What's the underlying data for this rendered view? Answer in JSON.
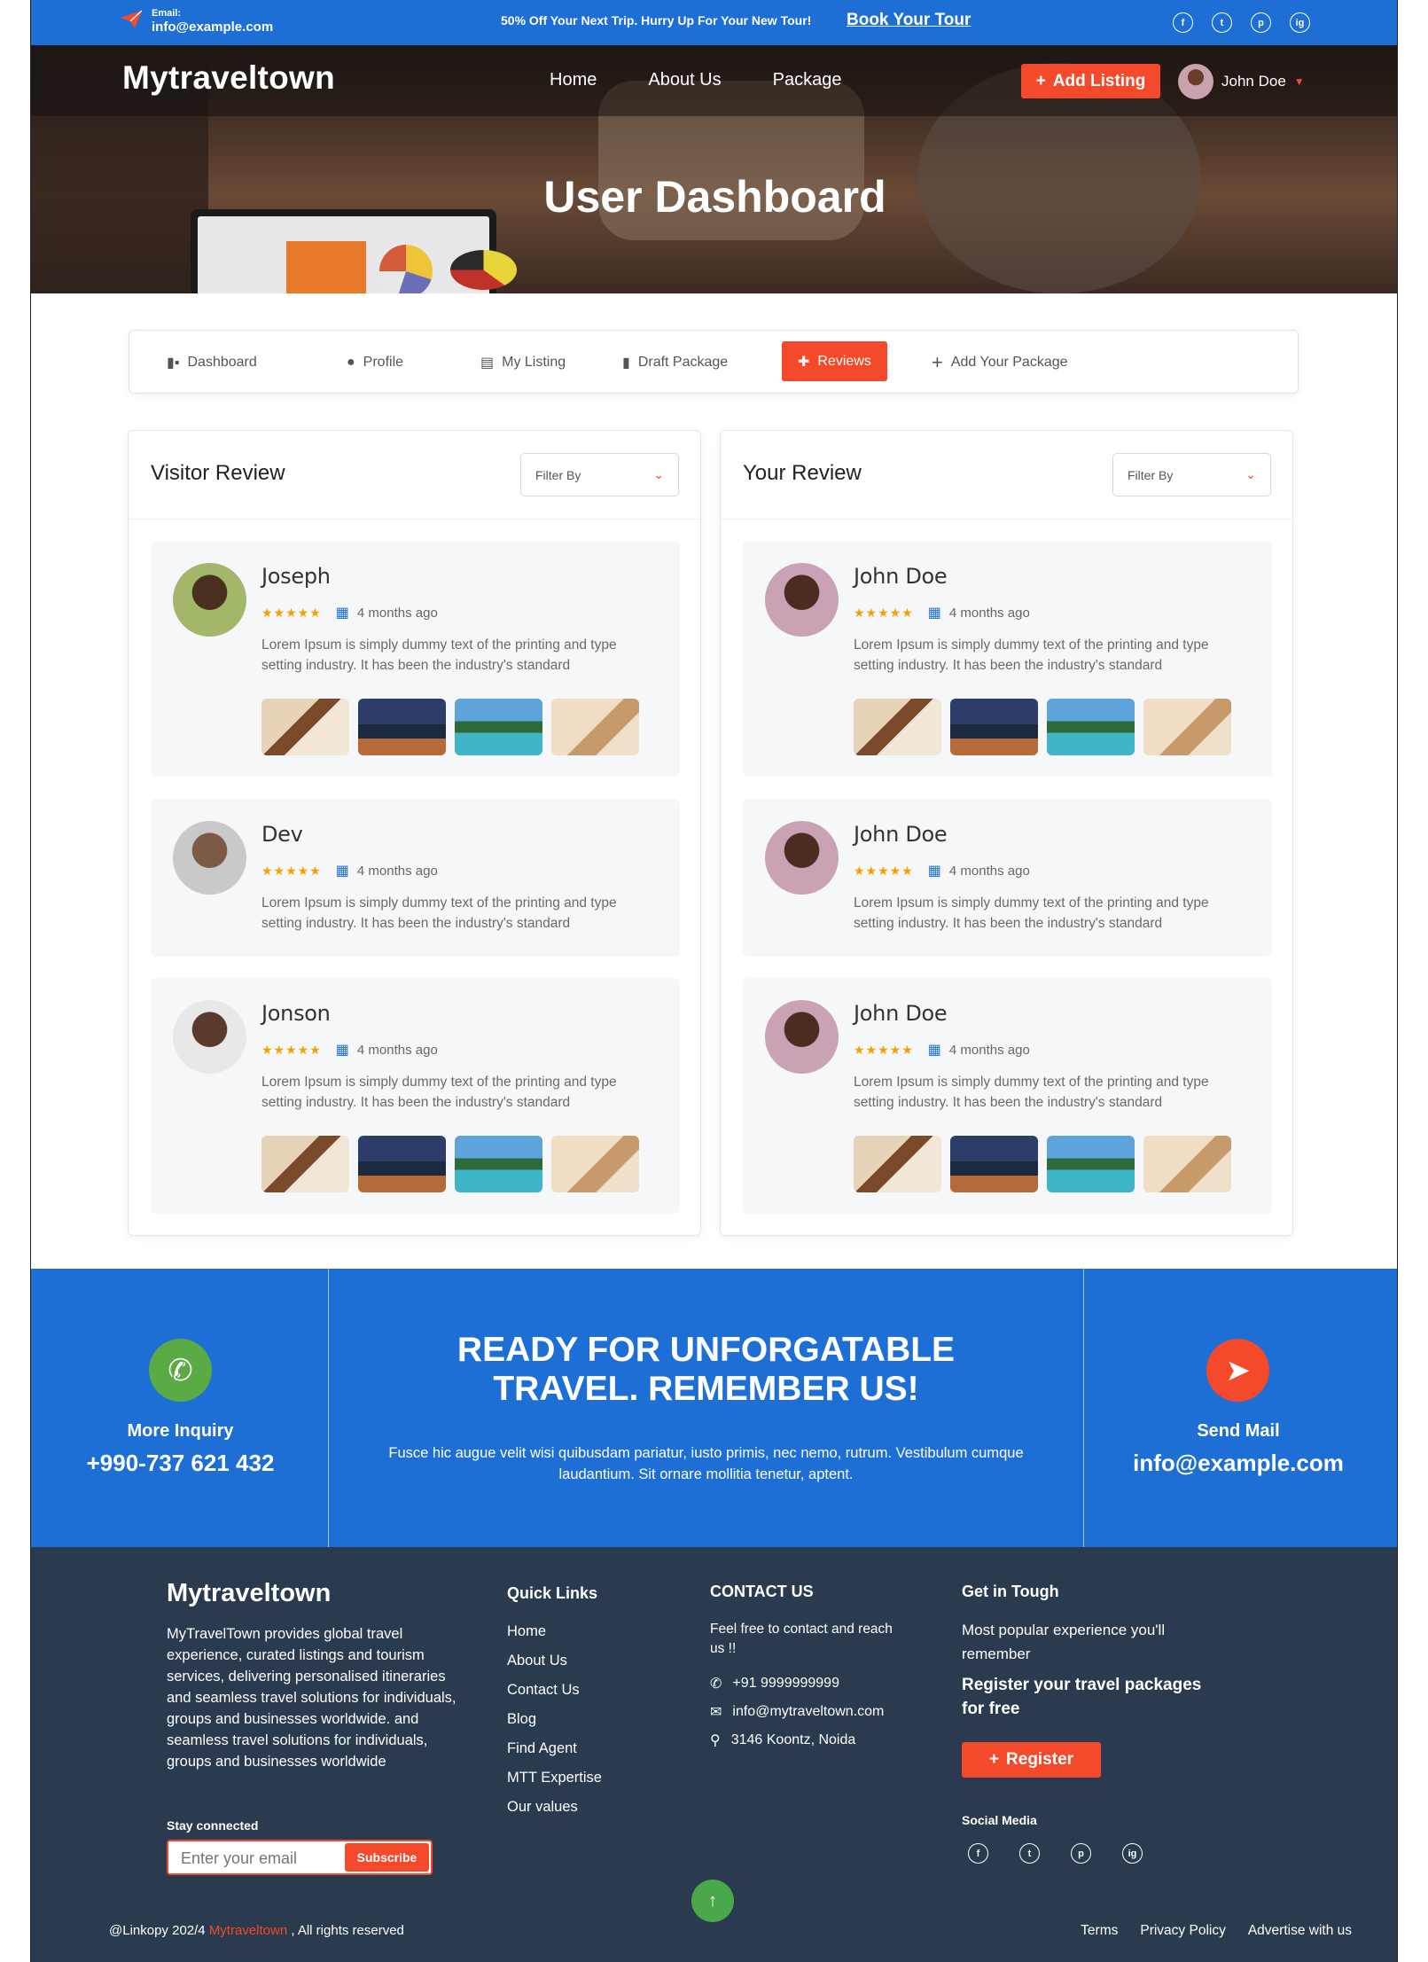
{
  "topbar": {
    "email_label": "Email:",
    "email_value": "info@example.com",
    "promo": "50% Off Your Next Trip. Hurry Up For Your New Tour!",
    "book_link": "Book Your Tour",
    "socials": [
      "f",
      "t",
      "p",
      "ig"
    ]
  },
  "header": {
    "logo": "Mytraveltown",
    "nav": [
      "Home",
      "About Us",
      "Package"
    ],
    "add_listing": "Add Listing",
    "user_name": "John Doe"
  },
  "hero": {
    "title": "User Dashboard"
  },
  "tabs": [
    {
      "label": "Dashboard",
      "icon": "dashboard-icon"
    },
    {
      "label": "Profile",
      "icon": "user-icon"
    },
    {
      "label": "My Listing",
      "icon": "list-icon"
    },
    {
      "label": "Draft Package",
      "icon": "document-icon"
    },
    {
      "label": "Reviews",
      "icon": "review-icon",
      "active": true
    },
    {
      "label": "Add Your Package",
      "icon": "plus-icon"
    }
  ],
  "visitor_review": {
    "title": "Visitor Review",
    "filter": "Filter By",
    "items": [
      {
        "name": "Joseph",
        "rating": 5,
        "date": "4 months ago",
        "text": "Lorem Ipsum is simply dummy text of the printing and type setting industry. It has been the industry's standard",
        "has_photos": true
      },
      {
        "name": "Dev",
        "rating": 5,
        "date": "4 months ago",
        "text": "Lorem Ipsum is simply dummy text of the printing and type setting industry. It has been the industry's standard",
        "has_photos": false
      },
      {
        "name": "Jonson",
        "rating": 5,
        "date": "4 months ago",
        "text": "Lorem Ipsum is simply dummy text of the printing and type setting industry. It has been the industry's standard",
        "has_photos": true
      }
    ]
  },
  "your_review": {
    "title": "Your Review",
    "filter": "Filter By",
    "items": [
      {
        "name": "John Doe",
        "rating": 5,
        "date": "4 months ago",
        "text": "Lorem Ipsum is simply dummy text of the printing and type setting industry. It has been the industry's standard",
        "has_photos": true
      },
      {
        "name": "John Doe",
        "rating": 5,
        "date": "4 months ago",
        "text": "Lorem Ipsum is simply dummy text of the printing and type setting industry. It has been the industry's standard",
        "has_photos": false
      },
      {
        "name": "John Doe",
        "rating": 5,
        "date": "4 months ago",
        "text": "Lorem Ipsum is simply dummy text of the printing and type setting industry. It has been the industry's standard",
        "has_photos": true
      }
    ]
  },
  "cta": {
    "inquiry_label": "More Inquiry",
    "phone": "+990-737 621 432",
    "headline_1": "READY FOR UNFORGATABLE",
    "headline_2": "TRAVEL. REMEMBER US!",
    "subtext": "Fusce hic augue velit wisi quibusdam pariatur, iusto primis, nec nemo, rutrum. Vestibulum cumque laudantium. Sit ornare mollitia tenetur, aptent.",
    "mail_label": "Send Mail",
    "mail": "info@example.com"
  },
  "footer": {
    "logo": "Mytraveltown",
    "about": "MyTravelTown provides global travel experience, curated listings and tourism services, delivering personalised itineraries and seamless travel solutions for individuals, groups and businesses worldwide.  and seamless travel solutions for individuals, groups and businesses worldwide",
    "stay_connected": "Stay connected",
    "email_placeholder": "Enter your email",
    "subscribe": "Subscribe",
    "quick_links_title": "Quick Links",
    "quick_links": [
      "Home",
      "About Us",
      "Contact Us",
      "Blog",
      "Find Agent",
      "MTT Expertise",
      "Our values"
    ],
    "contact_title": "CONTACT US",
    "contact_text": "Feel free to contact and reach us !!",
    "contact_phone": "+91 9999999999",
    "contact_email": "info@mytraveltown.com",
    "contact_address": "3146 Koontz, Noida",
    "get_title": "Get in Tough",
    "get_text": "Most popular experience you'll remember",
    "get_bold": "Register your travel packages for free",
    "register": "Register",
    "social_label": "Social Media",
    "copyright_pre": "@Linkopy 202/4 ",
    "copyright_brand": "Mytraveltown",
    "copyright_post": " , All rights reserved",
    "legal": [
      "Terms",
      "Privacy Policy",
      "Advertise with us"
    ]
  },
  "colors": {
    "primary": "#1d6fd6",
    "accent": "#f4492a",
    "footer": "#2a3a4f",
    "star": "#f5a000"
  }
}
